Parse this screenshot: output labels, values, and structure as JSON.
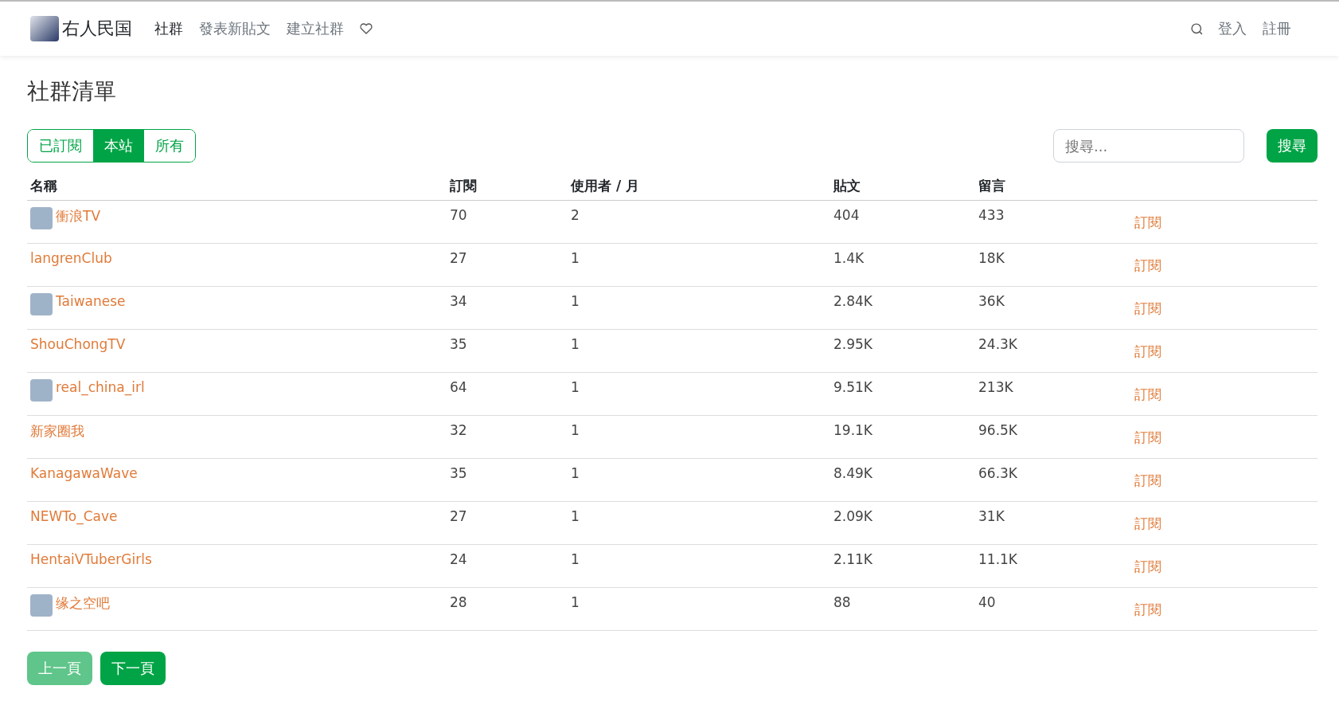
{
  "nav": {
    "brand": "右人民国",
    "links": [
      {
        "label": "社群",
        "selected": true
      },
      {
        "label": "發表新貼文",
        "selected": false
      },
      {
        "label": "建立社群",
        "selected": false
      }
    ],
    "auth": [
      "登入",
      "註冊"
    ]
  },
  "title": "社群清單",
  "filters": [
    {
      "label": "已訂閱",
      "selected": false
    },
    {
      "label": "本站",
      "selected": true
    },
    {
      "label": "所有",
      "selected": false
    }
  ],
  "search": {
    "placeholder": "搜尋...",
    "button": "搜尋"
  },
  "table": {
    "columns": [
      "名稱",
      "訂閱",
      "使用者 / 月",
      "貼文",
      "留言"
    ],
    "rows": [
      {
        "name": "衝浪TV",
        "icon": true,
        "subscribers": "70",
        "users_month": "2",
        "posts": "404",
        "comments": "433",
        "action": "訂閱"
      },
      {
        "name": "langrenClub",
        "icon": false,
        "subscribers": "27",
        "users_month": "1",
        "posts": "1.4K",
        "comments": "18K",
        "action": "訂閱"
      },
      {
        "name": "Taiwanese",
        "icon": true,
        "subscribers": "34",
        "users_month": "1",
        "posts": "2.84K",
        "comments": "36K",
        "action": "訂閱"
      },
      {
        "name": "ShouChongTV",
        "icon": false,
        "subscribers": "35",
        "users_month": "1",
        "posts": "2.95K",
        "comments": "24.3K",
        "action": "訂閱"
      },
      {
        "name": "real_china_irl",
        "icon": true,
        "subscribers": "64",
        "users_month": "1",
        "posts": "9.51K",
        "comments": "213K",
        "action": "訂閱"
      },
      {
        "name": "新家圈我",
        "icon": false,
        "subscribers": "32",
        "users_month": "1",
        "posts": "19.1K",
        "comments": "96.5K",
        "action": "訂閱"
      },
      {
        "name": "KanagawaWave",
        "icon": false,
        "subscribers": "35",
        "users_month": "1",
        "posts": "8.49K",
        "comments": "66.3K",
        "action": "訂閱"
      },
      {
        "name": "NEWTo_Cave",
        "icon": false,
        "subscribers": "27",
        "users_month": "1",
        "posts": "2.09K",
        "comments": "31K",
        "action": "訂閱"
      },
      {
        "name": "HentaiVTuberGirls",
        "icon": false,
        "subscribers": "24",
        "users_month": "1",
        "posts": "2.11K",
        "comments": "11.1K",
        "action": "訂閱"
      },
      {
        "name": "缘之空吧",
        "icon": true,
        "subscribers": "28",
        "users_month": "1",
        "posts": "88",
        "comments": "40",
        "action": "訂閱"
      }
    ]
  },
  "pagination": [
    {
      "label": "上一頁",
      "disabled": true
    },
    {
      "label": "下一頁",
      "disabled": false
    }
  ]
}
